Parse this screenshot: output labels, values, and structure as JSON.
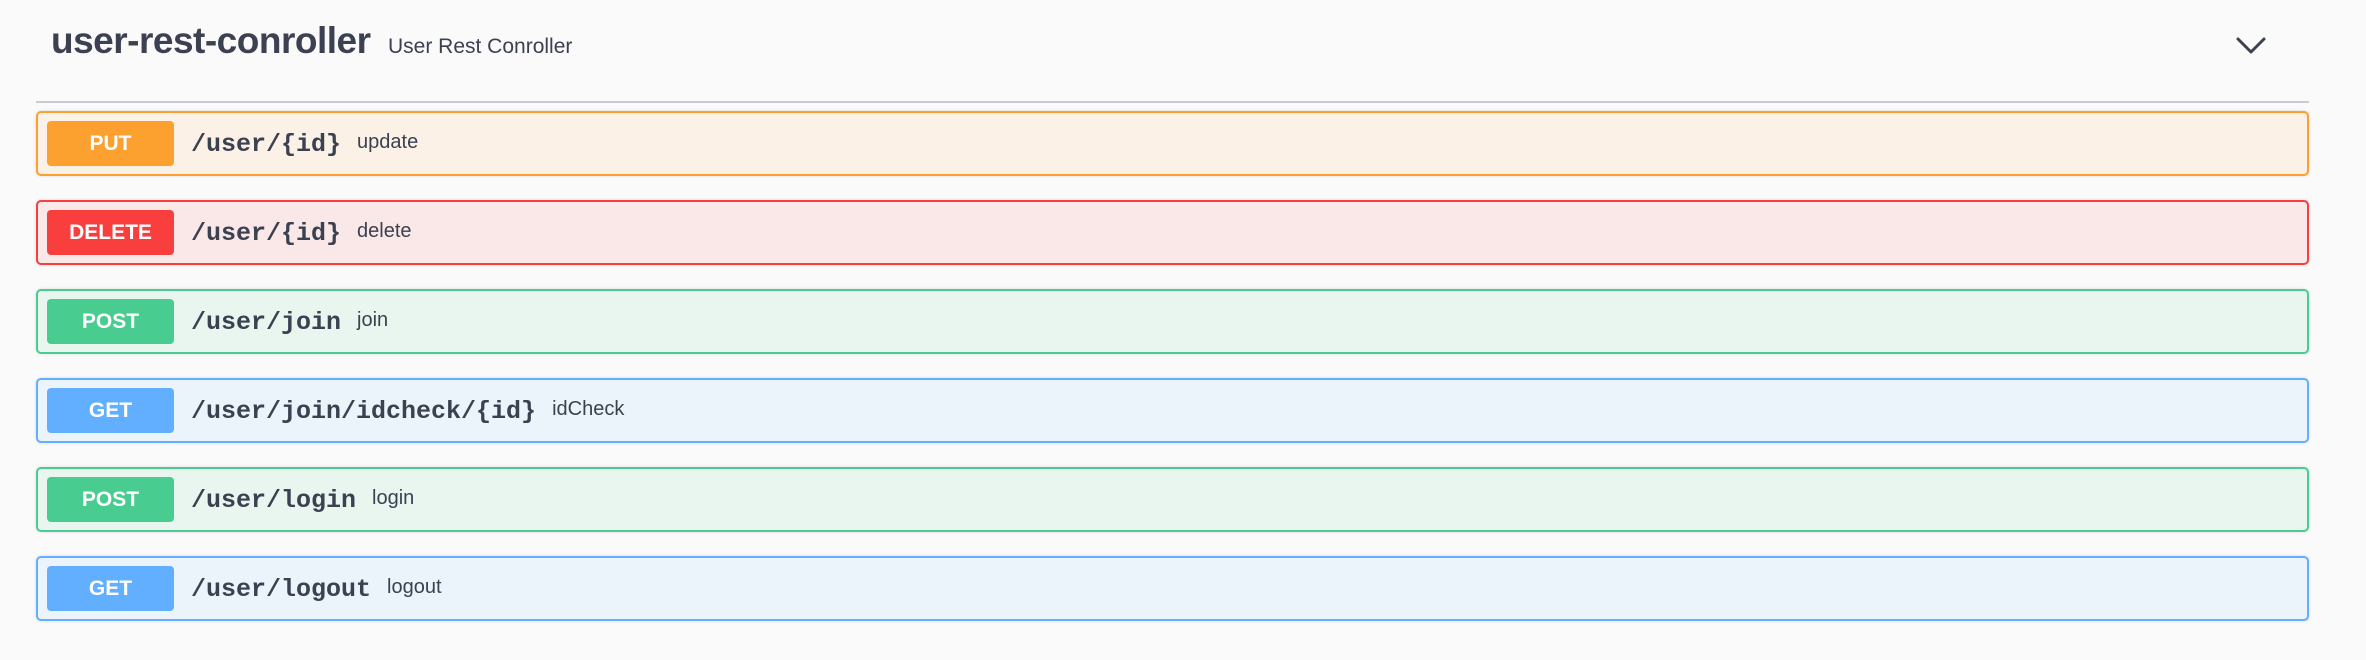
{
  "tag": {
    "name": "user-rest-conroller",
    "description": "User Rest Conroller",
    "toggle_icon": "chevron-down-icon"
  },
  "colors": {
    "PUT": {
      "badge": "#fca130",
      "bg": "#fbf1e6",
      "border": "#fca130"
    },
    "DELETE": {
      "badge": "#f93e3e",
      "bg": "#fae7e7",
      "border": "#f93e3e"
    },
    "POST": {
      "badge": "#49cc90",
      "bg": "#e8f6ef",
      "border": "#49cc90"
    },
    "GET": {
      "badge": "#61affe",
      "bg": "#ebf3fb",
      "border": "#61affe"
    }
  },
  "operations": [
    {
      "method": "PUT",
      "path": "/user/{id}",
      "summary": "update"
    },
    {
      "method": "DELETE",
      "path": "/user/{id}",
      "summary": "delete"
    },
    {
      "method": "POST",
      "path": "/user/join",
      "summary": "join"
    },
    {
      "method": "GET",
      "path": "/user/join/idcheck/{id}",
      "summary": "idCheck"
    },
    {
      "method": "POST",
      "path": "/user/login",
      "summary": "login"
    },
    {
      "method": "GET",
      "path": "/user/logout",
      "summary": "logout"
    }
  ]
}
